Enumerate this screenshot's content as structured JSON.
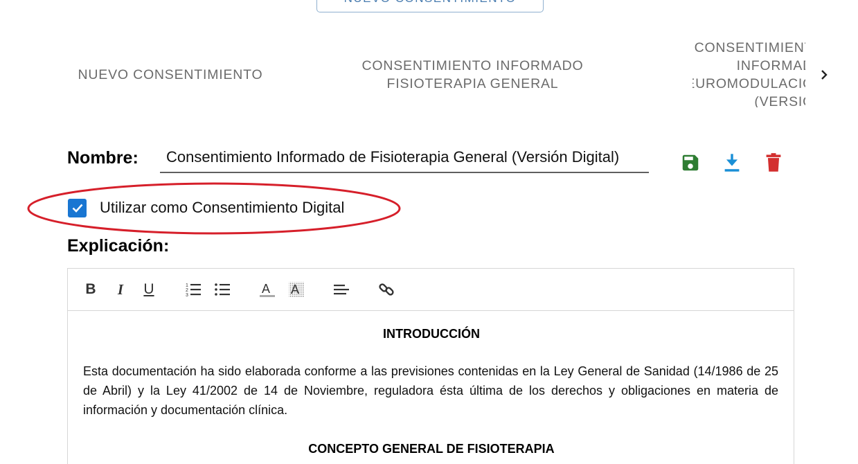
{
  "top_button": {
    "label": "NUEVO CONSENTIMIENTO"
  },
  "tabs": [
    {
      "label": "NUEVO CONSENTIMIENTO"
    },
    {
      "label_line1": "CONSENTIMIENTO INFORMADO",
      "label_line2": "FISIOTERAPIA GENERAL"
    },
    {
      "label_line1": "CONSENTIMIENTO INFORMADO",
      "label_line2": "NEUROMODULACIÓN",
      "label_line3": "(VERSIÓN"
    }
  ],
  "form": {
    "name_label": "Nombre:",
    "name_value": "Consentimiento Informado de Fisioterapia General (Versión Digital)",
    "digital_checkbox_label": "Utilizar como Consentimiento Digital",
    "digital_checked": true,
    "explanation_label": "Explicación:"
  },
  "actions": {
    "save_color": "#2e7d32",
    "download_color": "#1a8fd6",
    "delete_color": "#d32f2f"
  },
  "annotation": {
    "color": "#d61f2a"
  },
  "editor": {
    "toolbar": [
      "bold-icon",
      "italic-icon",
      "underline-icon",
      "ordered-list-icon",
      "bullet-list-icon",
      "text-color-icon",
      "highlight-color-icon",
      "align-left-icon",
      "link-icon"
    ],
    "heading1": "INTRODUCCIÓN",
    "paragraph1": "Esta documentación ha sido elaborada conforme a las previsiones contenidas en la Ley General de Sanidad (14/1986 de 25 de Abril) y la Ley 41/2002 de 14 de Noviembre, reguladora ésta última de los derechos y obligaciones en materia de información y documentación clínica.",
    "heading2": "CONCEPTO GENERAL DE FISIOTERAPIA"
  }
}
